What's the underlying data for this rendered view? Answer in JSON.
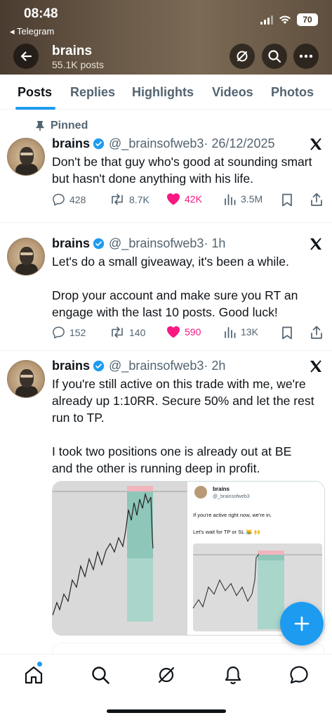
{
  "status_bar": {
    "time": "08:48",
    "back_app": "◂ Telegram",
    "battery": "70"
  },
  "profile": {
    "name": "brains",
    "posts_count": "55.1K posts"
  },
  "tabs": [
    {
      "label": "Posts",
      "active": true
    },
    {
      "label": "Replies",
      "active": false
    },
    {
      "label": "Highlights",
      "active": false
    },
    {
      "label": "Videos",
      "active": false
    },
    {
      "label": "Photos",
      "active": false
    }
  ],
  "posts": [
    {
      "pinned_label": "Pinned",
      "name": "brains",
      "handle": "@_brainsofweb3",
      "time": "· 26/12/2025",
      "text_lines": [
        "Don't be that guy who's good at sounding smart",
        "but hasn't done anything with his life."
      ],
      "replies": "428",
      "reposts": "8.7K",
      "likes": "42K",
      "views": "3.5M"
    },
    {
      "name": "brains",
      "handle": "@_brainsofweb3",
      "time": "· 1h",
      "text_lines": [
        "Let's do a small giveaway, it's been a while.",
        "",
        "Drop your account and make sure you RT an",
        "engage with the last 10 posts. Good luck!"
      ],
      "replies": "152",
      "reposts": "140",
      "likes": "590",
      "views": "13K"
    },
    {
      "name": "brains",
      "handle": "@_brainsofweb3",
      "time": "· 2h",
      "text_lines": [
        "If you're still active on this trade with me, we're",
        "already up 1:10RR. Secure 50% and let the rest",
        "run to TP.",
        "",
        "I took two positions one is already out at BE",
        "and the other is running deep in profit."
      ],
      "embedded": {
        "name": "brains",
        "handle": "@_brainsofweb3",
        "text1": "If you're active right now, we're in.",
        "text2": "Let's wait for TP or SL 😹 🙌"
      }
    }
  ],
  "colors": {
    "accent": "#1d9bf0",
    "like": "#f91880",
    "muted": "#536471",
    "text": "#0f1419"
  },
  "icons": [
    "back-arrow-icon",
    "grok-icon",
    "search-icon",
    "more-icon",
    "pin-icon",
    "verified-icon",
    "x-logo-icon",
    "reply-icon",
    "repost-icon",
    "heart-icon",
    "views-icon",
    "bookmark-icon",
    "share-icon",
    "plus-icon",
    "home-icon",
    "notifications-icon",
    "messages-icon"
  ]
}
